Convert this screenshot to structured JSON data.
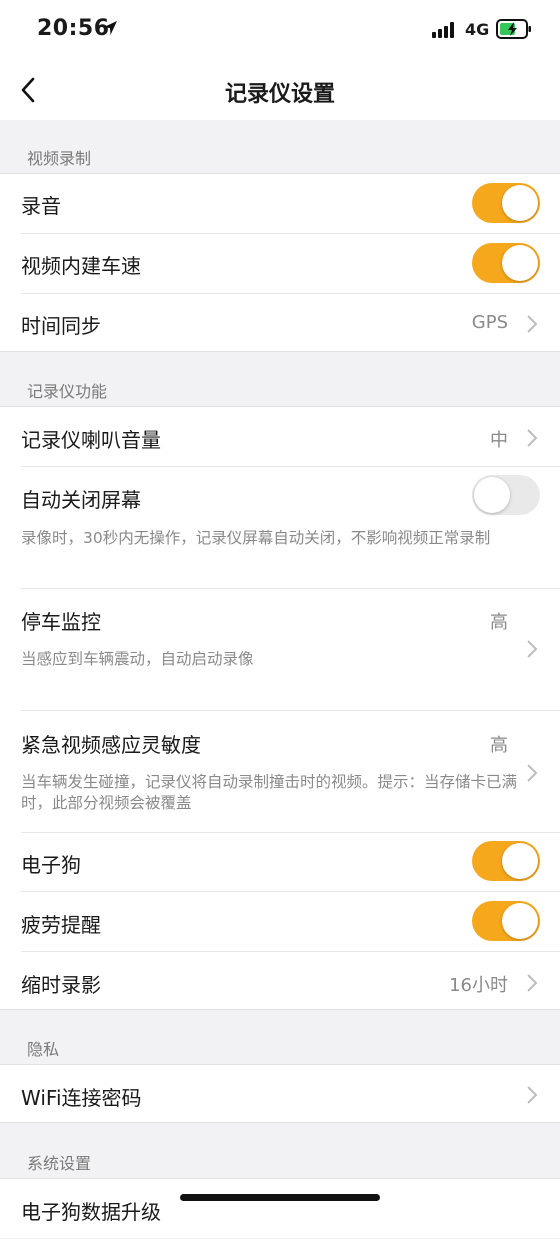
{
  "status_bar": {
    "time": "20:56",
    "network": "4G"
  },
  "nav": {
    "title": "记录仪设置"
  },
  "sections": {
    "video": {
      "label": "视频录制",
      "items": [
        {
          "title": "录音",
          "toggle": true
        },
        {
          "title": "视频内建车速",
          "toggle": true
        },
        {
          "title": "时间同步",
          "value": "GPS"
        }
      ]
    },
    "functions": {
      "label": "记录仪功能",
      "items": [
        {
          "title": "记录仪喇叭音量",
          "value": "中"
        },
        {
          "title": "自动关闭屏幕",
          "toggle": false,
          "description": "录像时，30秒内无操作，记录仪屏幕自动关闭，不影响视频正常录制"
        },
        {
          "title": "停车监控",
          "value": "高",
          "description": "当感应到车辆震动，自动启动录像"
        },
        {
          "title": "紧急视频感应灵敏度",
          "value": "高",
          "description": "当车辆发生碰撞，记录仪将自动录制撞击时的视频。提示：当存储卡已满时，此部分视频会被覆盖"
        },
        {
          "title": "电子狗",
          "toggle": true
        },
        {
          "title": "疲劳提醒",
          "toggle": true
        },
        {
          "title": "缩时录影",
          "value": "16小时"
        }
      ]
    },
    "privacy": {
      "label": "隐私",
      "items": [
        {
          "title": "WiFi连接密码"
        }
      ]
    },
    "system": {
      "label": "系统设置",
      "items": [
        {
          "title": "电子狗数据升级"
        }
      ]
    }
  },
  "colors": {
    "accent": "#f6a81c",
    "background": "#f2f2f4"
  }
}
